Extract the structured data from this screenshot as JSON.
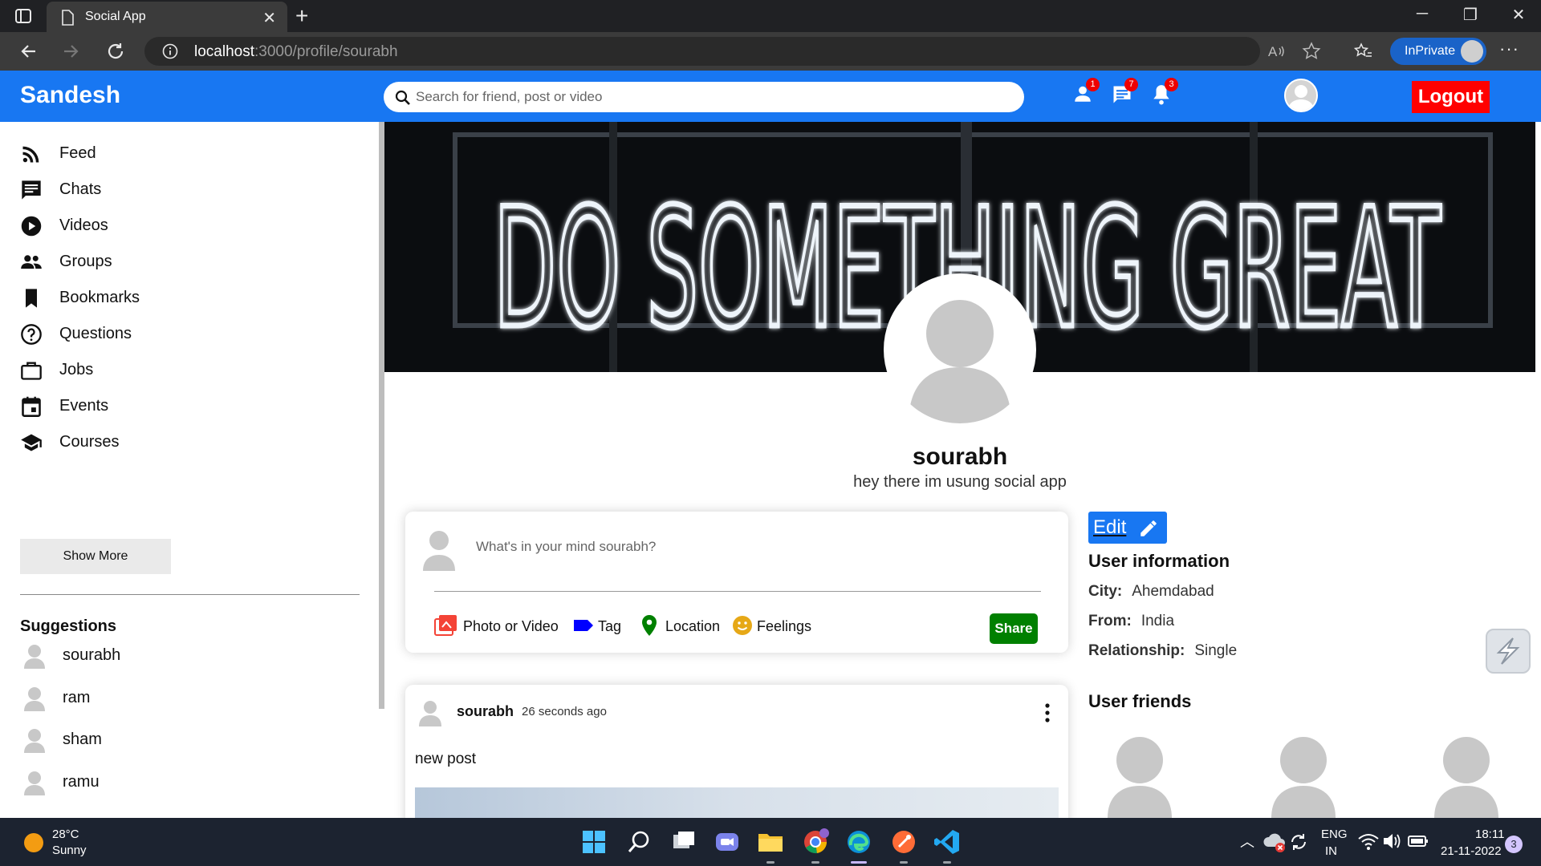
{
  "browser": {
    "tab_title": "Social App",
    "url_host": "localhost",
    "url_path": ":3000/profile/sourabh",
    "inprivate_label": "InPrivate"
  },
  "topbar": {
    "brand": "Sandesh",
    "search_placeholder": "Search for friend, post or video",
    "badges": {
      "friends": "1",
      "messages": "7",
      "notifications": "3"
    },
    "logout_label": "Logout",
    "accent_color": "#1877f2",
    "logout_color": "#ff0000"
  },
  "sidebar": {
    "items": [
      {
        "label": "Feed",
        "icon": "rss-feed-icon"
      },
      {
        "label": "Chats",
        "icon": "chat-icon"
      },
      {
        "label": "Videos",
        "icon": "play-circle-icon"
      },
      {
        "label": "Groups",
        "icon": "group-icon"
      },
      {
        "label": "Bookmarks",
        "icon": "bookmark-icon"
      },
      {
        "label": "Questions",
        "icon": "help-circle-icon"
      },
      {
        "label": "Jobs",
        "icon": "briefcase-icon"
      },
      {
        "label": "Events",
        "icon": "calendar-icon"
      },
      {
        "label": "Courses",
        "icon": "school-icon"
      }
    ],
    "show_more_label": "Show More",
    "suggestions_title": "Suggestions",
    "suggestions": [
      "sourabh",
      "ram",
      "sham",
      "ramu"
    ]
  },
  "profile": {
    "cover_text": "DO SOMETHING GREAT",
    "name": "sourabh",
    "description": "hey there im usung social app"
  },
  "composer": {
    "placeholder": "What's in your mind sourabh?",
    "options": [
      {
        "label": "Photo or Video",
        "icon": "photo-library-icon",
        "color": "#f44336"
      },
      {
        "label": "Tag",
        "icon": "label-icon",
        "color": "#0000ff"
      },
      {
        "label": "Location",
        "icon": "location-pin-icon",
        "color": "#008000"
      },
      {
        "label": "Feelings",
        "icon": "emoji-icon",
        "color": "#e6a817"
      }
    ],
    "share_label": "Share"
  },
  "post": {
    "author": "sourabh",
    "time": "26 seconds ago",
    "text": "new post"
  },
  "user_info": {
    "edit_label": "Edit",
    "title": "User information",
    "rows": [
      {
        "key": "City:",
        "value": "Ahemdabad"
      },
      {
        "key": "From:",
        "value": "India"
      },
      {
        "key": "Relationship:",
        "value": "Single"
      }
    ],
    "friends_title": "User friends"
  },
  "taskbar": {
    "temperature": "28°C",
    "condition": "Sunny",
    "lang_1": "ENG",
    "lang_2": "IN",
    "time": "18:11",
    "date": "21-11-2022",
    "notification_count": "3"
  }
}
